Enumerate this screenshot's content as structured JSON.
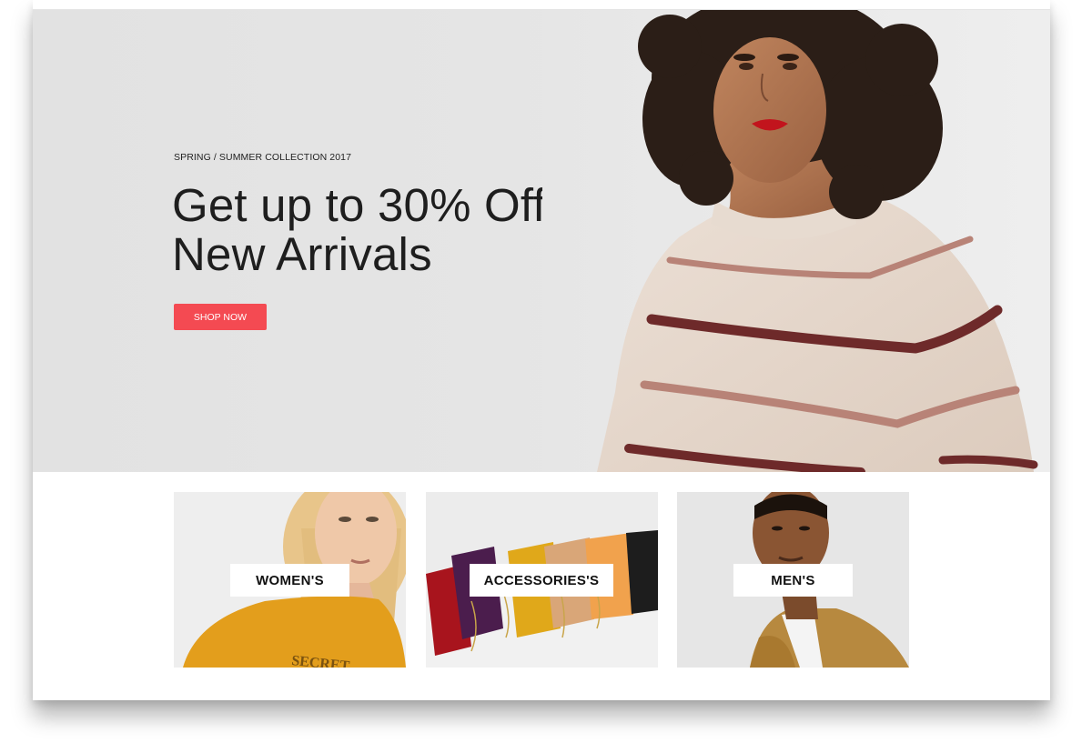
{
  "hero": {
    "eyebrow": "SPRING / SUMMER COLLECTION 2017",
    "headline_line1": "Get up to 30% Off",
    "headline_line2": "New Arrivals",
    "button_label": "SHOP NOW",
    "button_color": "#f44a52",
    "image_icon": "model-striped-sweater-photo"
  },
  "categories": [
    {
      "label": "WOMEN'S",
      "image_icon": "woman-yellow-top-photo"
    },
    {
      "label": "ACCESSORIES'S",
      "image_icon": "handbags-row-photo"
    },
    {
      "label": "MEN'S",
      "image_icon": "man-khaki-jacket-photo"
    }
  ]
}
